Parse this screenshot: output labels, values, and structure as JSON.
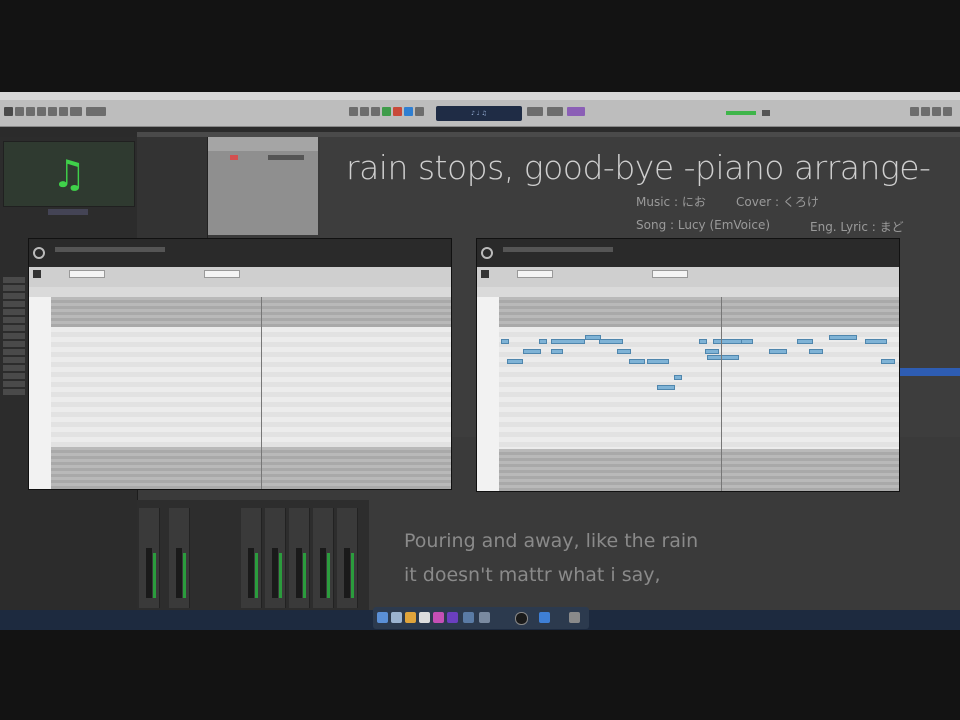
{
  "video": {
    "title": "rain stops, good-bye -piano arrange-",
    "credits": {
      "music_label": "Music",
      "music_value": "にお",
      "cover_label": "Cover",
      "cover_value": "くろけ",
      "song_label": "Song",
      "song_value": "Lucy (EmVoice)",
      "eng_lyric_label": "Eng. Lyric",
      "eng_lyric_value": "まど"
    },
    "lyrics": [
      "Pouring and away, like the rain",
      "it doesn't mattr what i say,"
    ]
  },
  "app": {
    "lcd_text": "♪ ♩ ♫",
    "colors": {
      "note": "#7fb3d6",
      "art_note": "#3fd14a",
      "title_text": "#cfcfcf",
      "dock": "#2c3a4e"
    },
    "icons": [
      "music-note-icon",
      "power-icon",
      "dock-icons"
    ]
  },
  "piano_rolls": [
    {
      "label": "piano-roll-left",
      "has_notes": false
    },
    {
      "label": "piano-roll-right",
      "has_notes": true
    }
  ]
}
